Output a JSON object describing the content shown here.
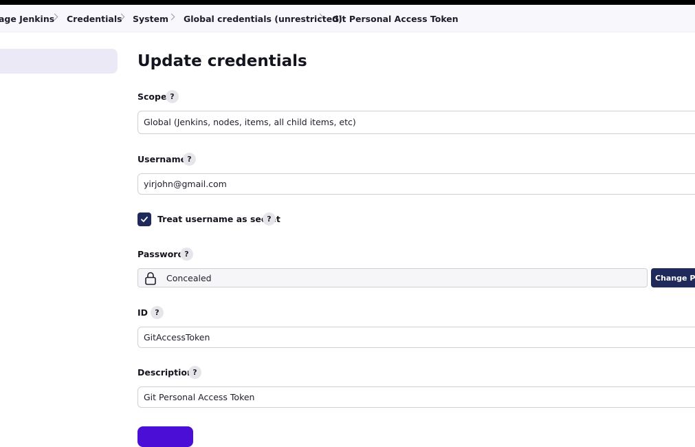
{
  "breadcrumb": [
    {
      "label": "age Jenkins"
    },
    {
      "label": "Credentials"
    },
    {
      "label": "System"
    },
    {
      "label": "Global credentials (unrestricted)"
    },
    {
      "label": "Git Personal Access Token"
    }
  ],
  "page_title": "Update credentials",
  "form": {
    "scope": {
      "label": "Scope",
      "value": "Global (Jenkins, nodes, items, all child items, etc)"
    },
    "username": {
      "label": "Username",
      "value": "yirjohn@gmail.com"
    },
    "treat_secret": {
      "label": "Treat username as secret",
      "checked": true
    },
    "password": {
      "label": "Password",
      "value": "Concealed",
      "button": "Change Password"
    },
    "id": {
      "label": "ID",
      "value": "GitAccessToken"
    },
    "description": {
      "label": "Description",
      "value": "Git Personal Access Token"
    }
  },
  "help_glyph": "?",
  "colors": {
    "primary_button": "#4b0ed6",
    "dark_button": "#1f2a5b",
    "sidebar_highlight": "#ece9f6"
  },
  "icons": {
    "crumb_separator": "chevron-right-icon",
    "password": "lock-icon",
    "checkbox": "check-icon"
  }
}
